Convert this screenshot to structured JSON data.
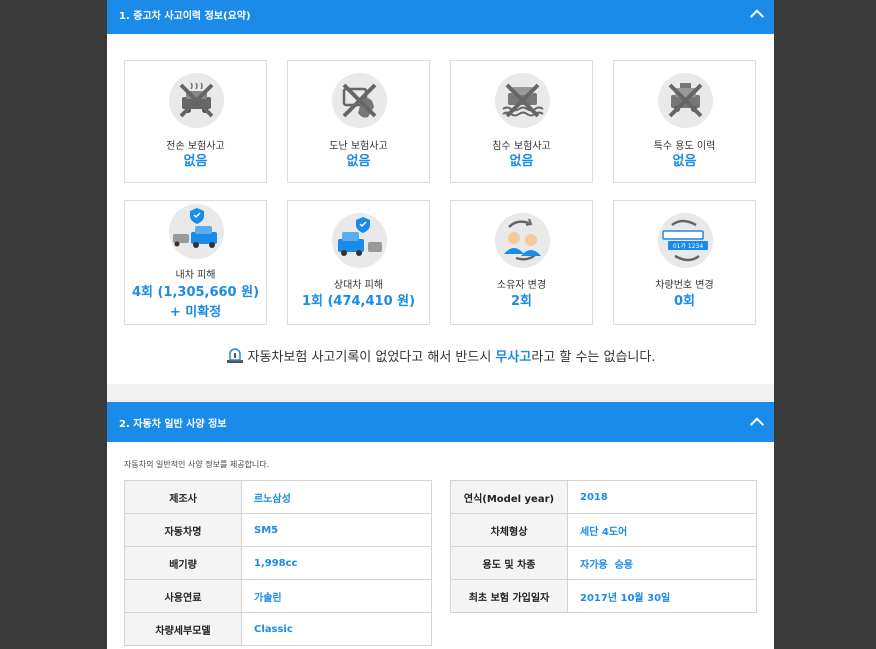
{
  "section1": {
    "title": "1. 중고차 사고이력 정보(요약)",
    "cards": [
      {
        "label": "전손 보험사고",
        "value": "없음",
        "icon": "total-loss-car-icon"
      },
      {
        "label": "도난 보험사고",
        "value": "없음",
        "icon": "theft-icon"
      },
      {
        "label": "침수 보험사고",
        "value": "없음",
        "icon": "flood-car-icon"
      },
      {
        "label": "특수 용도 이력",
        "value": "없음",
        "icon": "taxi-icon"
      },
      {
        "label": "내차 피해",
        "value": "4회 (1,305,660 원) + 미확정",
        "icon": "own-damage-icon"
      },
      {
        "label": "상대차 피해",
        "value": "1회 (474,410 원)",
        "icon": "other-damage-icon"
      },
      {
        "label": "소유자 변경",
        "value": "2회",
        "icon": "owner-change-icon"
      },
      {
        "label": "차량번호 변경",
        "value": "0회",
        "icon": "plate-change-icon"
      }
    ],
    "notice": {
      "before": "자동차보험 사고기록이 없었다고 해서 반드시 ",
      "highlight": "무사고",
      "after": "라고 할 수는 없습니다."
    }
  },
  "section2": {
    "title": "2. 자동차 일반 사양 정보",
    "description": "자동차의 일반적인 사양 정보를 제공합니다.",
    "left_rows": [
      {
        "key": "제조사",
        "value": "르노삼성"
      },
      {
        "key": "자동차명",
        "value": "SM5"
      },
      {
        "key": "배기량",
        "value": "1,998cc"
      },
      {
        "key": "사용연료",
        "value": "가솔린"
      },
      {
        "key": "차량세부모델",
        "value": "Classic"
      }
    ],
    "right_rows": [
      {
        "key": "연식(Model year)",
        "value": "2018"
      },
      {
        "key": "차체형상",
        "value": "세단 4도어"
      },
      {
        "key": "용도 및 차종",
        "value": "자가용  승용"
      },
      {
        "key": "최초 보험 가입일자",
        "value": "2017년 10월 30일"
      }
    ]
  },
  "colors": {
    "accent": "#1a8be8",
    "background": "#3a3a3a",
    "panel": "#ffffff"
  }
}
